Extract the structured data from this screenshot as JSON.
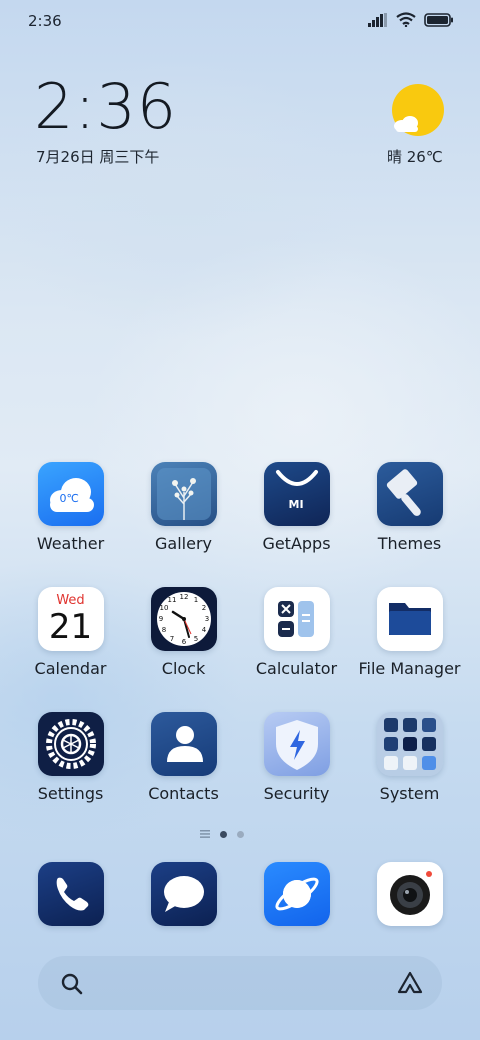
{
  "status": {
    "time": "2:36"
  },
  "lockscreen": {
    "time": "2:36",
    "date": "7月26日 周三下午",
    "weather": "晴 26℃"
  },
  "apps": [
    {
      "label": "Weather",
      "icon": "weather-icon",
      "badge": "0℃"
    },
    {
      "label": "Gallery",
      "icon": "gallery-icon"
    },
    {
      "label": "GetApps",
      "icon": "getapps-icon",
      "badge": "MI"
    },
    {
      "label": "Themes",
      "icon": "themes-icon"
    },
    {
      "label": "Calendar",
      "icon": "calendar-icon",
      "day_name": "Wed",
      "day_num": "21"
    },
    {
      "label": "Clock",
      "icon": "clock-icon"
    },
    {
      "label": "Calculator",
      "icon": "calculator-icon"
    },
    {
      "label": "File Manager",
      "icon": "folder-icon"
    },
    {
      "label": "Settings",
      "icon": "gear-icon"
    },
    {
      "label": "Contacts",
      "icon": "contacts-icon"
    },
    {
      "label": "Security",
      "icon": "shield-icon"
    },
    {
      "label": "System",
      "icon": "folder-grid-icon"
    }
  ],
  "dock": [
    {
      "icon": "phone-icon"
    },
    {
      "icon": "messages-icon"
    },
    {
      "icon": "browser-icon"
    },
    {
      "icon": "camera-icon"
    }
  ],
  "search": {
    "icon": "search-icon",
    "assistant_icon": "assistant-icon"
  },
  "colors": {
    "accent_blue": "#1a7cf0",
    "navy": "#0f2556",
    "sun": "#f9c90f"
  }
}
